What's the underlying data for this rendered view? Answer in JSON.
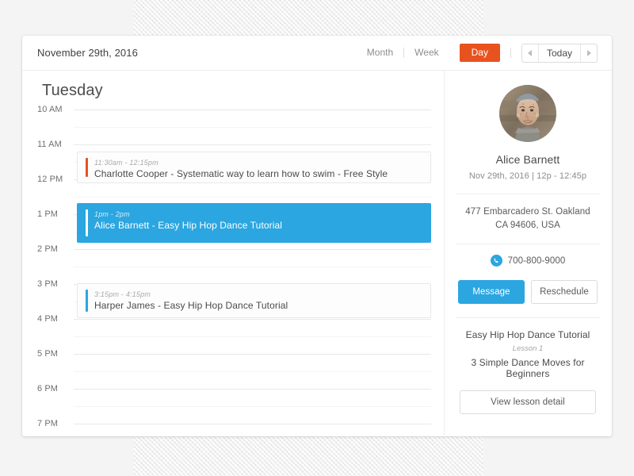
{
  "header": {
    "date_label": "November 29th, 2016",
    "views": [
      {
        "label": "Month",
        "active": false
      },
      {
        "label": "Week",
        "active": false
      },
      {
        "label": "Day",
        "active": true
      }
    ],
    "today_label": "Today",
    "prev_icon": "triangle-left-icon",
    "next_icon": "triangle-right-icon"
  },
  "calendar": {
    "day_title": "Tuesday",
    "hours": [
      "10 AM",
      "11 AM",
      "12 PM",
      "1 PM",
      "2 PM",
      "3 PM",
      "4 PM",
      "5 PM",
      "6 PM",
      "7 PM"
    ],
    "events": [
      {
        "time": "11:30am - 12:15pm",
        "title": "Charlotte Cooper - Systematic way to learn how to swim - Free Style",
        "accent": "#e8521f",
        "selected": false
      },
      {
        "time": "1pm - 2pm",
        "title": "Alice Barnett - Easy Hip Hop Dance Tutorial",
        "accent": "#ffffff",
        "selected": true
      },
      {
        "time": "3:15pm - 4:15pm",
        "title": "Harper James - Easy Hip Hop Dance Tutorial",
        "accent": "#2ba6e0",
        "selected": false
      }
    ]
  },
  "detail": {
    "avatar_icon": "user-photo-avatar",
    "name": "Alice Barnett",
    "when": "Nov 29th, 2016  |  12p - 12:45p",
    "address": "477 Embarcadero St. Oakland CA 94606, USA",
    "phone_icon": "phone-icon",
    "phone": "700-800-9000",
    "message_label": "Message",
    "reschedule_label": "Reschedule",
    "lesson_title": "Easy Hip Hop Dance Tutorial",
    "lesson_number": "Lesson 1",
    "lesson_subtitle": "3 Simple Dance Moves for Beginners",
    "lesson_detail_label": "View lesson detail"
  },
  "colors": {
    "accent_orange": "#e8521f",
    "accent_blue": "#2ba6e0",
    "page_bg": "#f4f4f4",
    "card_bg": "#ffffff"
  }
}
